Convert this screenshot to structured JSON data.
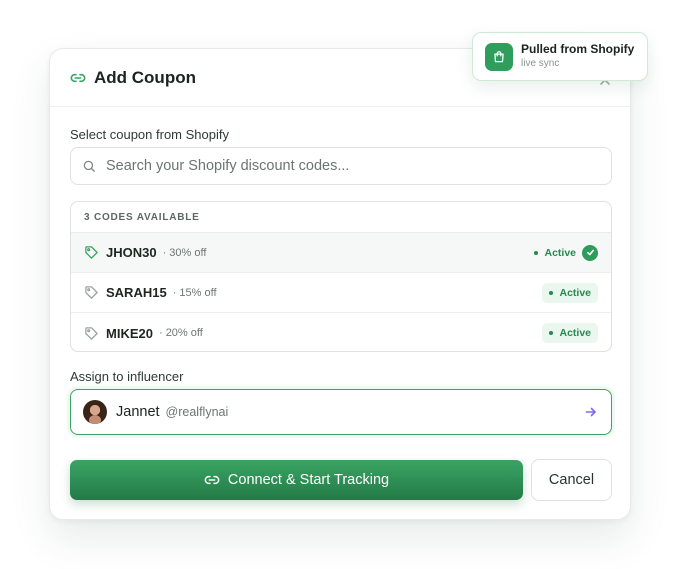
{
  "dialog": {
    "title": "Add Coupon",
    "title_icon": "link-icon"
  },
  "toast": {
    "title": "Pulled from Shopify",
    "subtitle": "live sync",
    "icon": "shopping-bag-icon"
  },
  "coupon_select": {
    "label": "Select coupon from Shopify",
    "search_placeholder": "Search your Shopify discount codes...",
    "search_value": ""
  },
  "codes": {
    "header": "3 CODES AVAILABLE",
    "items": [
      {
        "code": "JHON30",
        "discount": "· 30% off",
        "status": "Active",
        "selected": true
      },
      {
        "code": "SARAH15",
        "discount": "· 15% off",
        "status": "Active",
        "selected": false
      },
      {
        "code": "MIKE20",
        "discount": "· 20% off",
        "status": "Active",
        "selected": false
      }
    ]
  },
  "influencer": {
    "label": "Assign to influencer",
    "name": "Jannet",
    "handle": "@realflynai"
  },
  "actions": {
    "primary_label": "Connect & Start Tracking",
    "cancel_label": "Cancel"
  },
  "colors": {
    "accent": "#2f9d5c",
    "accent_dark": "#237a46",
    "badge_bg": "#eaf7ef",
    "arrow": "#7a6cf0"
  }
}
